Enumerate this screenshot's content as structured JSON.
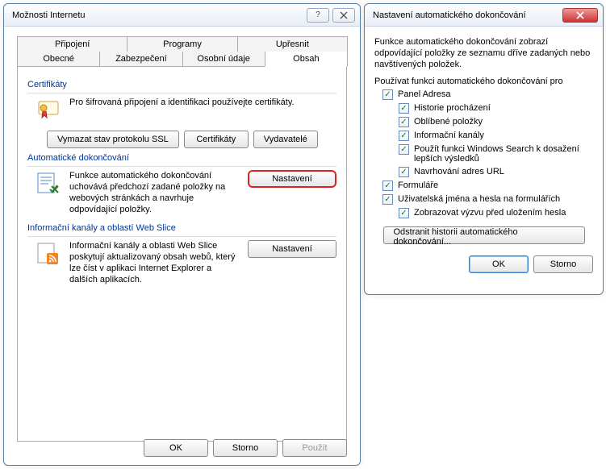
{
  "left": {
    "title": "Možnosti Internetu",
    "tabs_top": [
      "Připojení",
      "Programy",
      "Upřesnit"
    ],
    "tabs_bottom": [
      "Obecné",
      "Zabezpečení",
      "Osobní údaje",
      "Obsah"
    ],
    "active_tab": "Obsah",
    "cert": {
      "label": "Certifikáty",
      "desc": "Pro šifrovaná připojení a identifikaci používejte certifikáty.",
      "btn_clear": "Vymazat stav protokolu SSL",
      "btn_certs": "Certifikáty",
      "btn_publishers": "Vydavatelé"
    },
    "auto": {
      "label": "Automatické dokončování",
      "desc": "Funkce automatického dokončování uchovává předchozí zadané položky na webových stránkách a navrhuje odpovídající položky.",
      "btn": "Nastavení"
    },
    "feeds": {
      "label": "Informační kanály a oblastí Web Slice",
      "desc": "Informační kanály a oblasti Web Slice poskytují aktualizovaný obsah webů, který lze číst v aplikaci Internet Explorer a dalších aplikacích.",
      "btn": "Nastavení"
    },
    "buttons": {
      "ok": "OK",
      "cancel": "Storno",
      "apply": "Použít"
    }
  },
  "right": {
    "title": "Nastavení automatického dokončování",
    "desc": "Funkce automatického dokončování zobrazí odpovídající položky ze seznamu dříve zadaných nebo navštívených položek.",
    "group_label": "Používat funkci automatického dokončování pro",
    "items": {
      "addressbar": "Panel Adresa",
      "history": "Historie procházení",
      "favorites": "Oblíbené položky",
      "feeds": "Informační kanály",
      "winsearch": "Použít funkci Windows Search k dosažení lepších výsledků",
      "suggest": "Navrhování adres URL",
      "forms": "Formuláře",
      "userpass": "Uživatelská jména a hesla na formulářích",
      "prompt": "Zobrazovat výzvu před uložením hesla"
    },
    "btn_remove": "Odstranit historii automatického dokončování...",
    "buttons": {
      "ok": "OK",
      "cancel": "Storno"
    }
  }
}
